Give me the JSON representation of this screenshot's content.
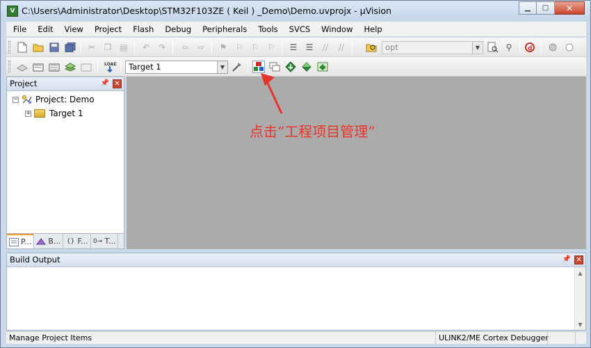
{
  "window": {
    "title": "C:\\Users\\Administrator\\Desktop\\STM32F103ZE ( Keil ) _Demo\\Demo.uvprojx - µVision",
    "icon": "keil-uv-icon",
    "buttons": {
      "minimize": "▁",
      "maximize": "□",
      "close": "✕"
    }
  },
  "menu": [
    "File",
    "Edit",
    "View",
    "Project",
    "Flash",
    "Debug",
    "Peripherals",
    "Tools",
    "SVCS",
    "Window",
    "Help"
  ],
  "toolbar": {
    "find_value": "opt",
    "target_value": "Target 1"
  },
  "project_pane": {
    "title": "Project",
    "tree": [
      {
        "label": "Project: Demo",
        "expanded": true
      },
      {
        "label": "Target 1",
        "expanded": false
      }
    ],
    "tabs": [
      {
        "label": "P...",
        "icon": "project-tab-icon",
        "selected": true
      },
      {
        "label": "B...",
        "icon": "books-tab-icon",
        "selected": false
      },
      {
        "label": "F...",
        "icon": "functions-tab-icon",
        "selected": false
      },
      {
        "label": "T...",
        "icon": "templates-tab-icon",
        "selected": false
      }
    ]
  },
  "build_output": {
    "title": "Build Output"
  },
  "status": {
    "left": "Manage Project Items",
    "right": "ULINK2/ME Cortex Debugger"
  },
  "annotation": {
    "text": "点击“工程项目管理”",
    "color": "#e8352b"
  },
  "colors": {
    "editor_bg": "#ababab",
    "title_gradient_top": "#dbe7f5",
    "accent_annotation": "#e8352b"
  }
}
